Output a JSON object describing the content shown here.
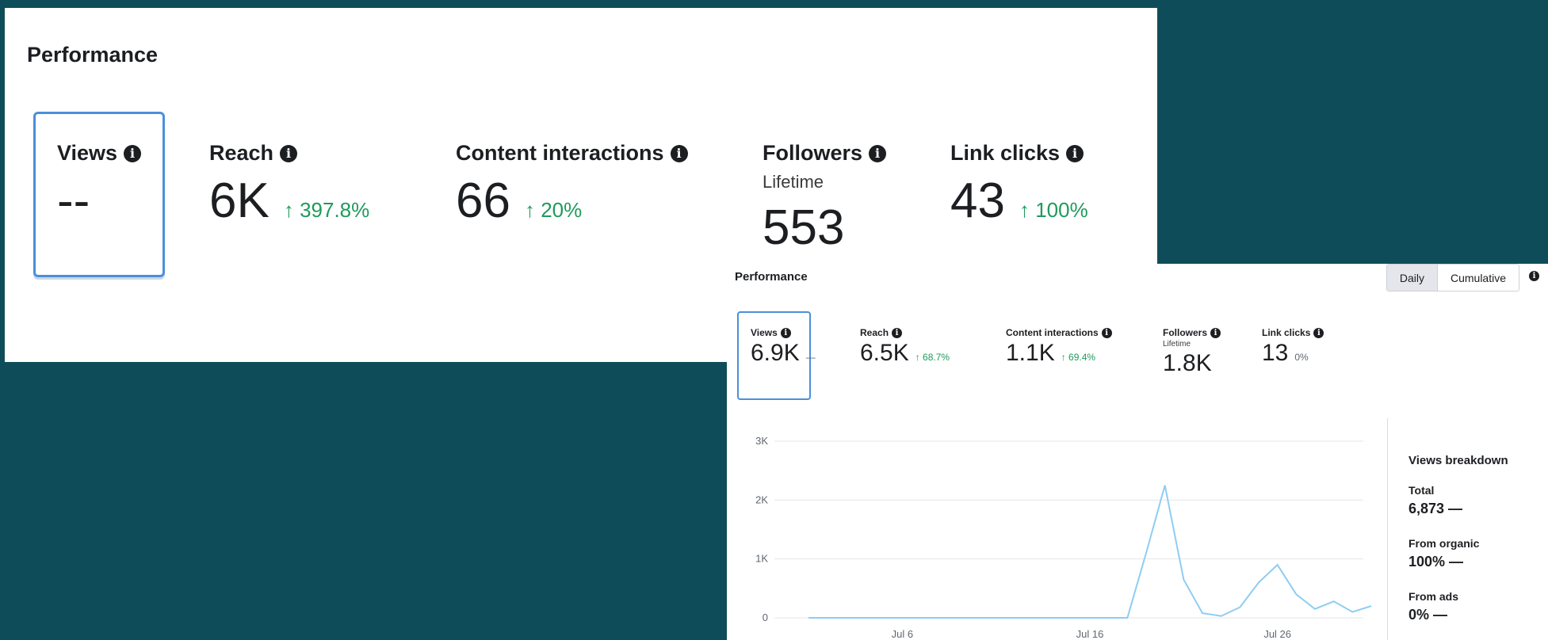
{
  "panel1": {
    "title": "Performance",
    "metrics": [
      {
        "label": "Views",
        "value": "--",
        "delta": ""
      },
      {
        "label": "Reach",
        "value": "6K",
        "delta": "↑ 397.8%"
      },
      {
        "label": "Content interactions",
        "value": "66",
        "delta": "↑ 20%"
      },
      {
        "label": "Followers",
        "sub": "Lifetime",
        "value": "553",
        "delta": ""
      },
      {
        "label": "Link clicks",
        "value": "43",
        "delta": "↑ 100%"
      }
    ]
  },
  "panel2": {
    "title": "Performance",
    "toggle": {
      "daily": "Daily",
      "cumulative": "Cumulative"
    },
    "metrics": [
      {
        "label": "Views",
        "value": "6.9K",
        "delta": "—"
      },
      {
        "label": "Reach",
        "value": "6.5K",
        "delta": "↑ 68.7%"
      },
      {
        "label": "Content interactions",
        "value": "1.1K",
        "delta": "↑ 69.4%"
      },
      {
        "label": "Followers",
        "sub": "Lifetime",
        "value": "1.8K",
        "delta": ""
      },
      {
        "label": "Link clicks",
        "value": "13",
        "delta": "0%"
      }
    ],
    "breakdown": {
      "title": "Views breakdown",
      "items": [
        {
          "label": "Total",
          "value": "6,873 —"
        },
        {
          "label": "From organic",
          "value": "100% —"
        },
        {
          "label": "From ads",
          "value": "0% —"
        }
      ]
    }
  },
  "colors": {
    "line": "#8ecdf2",
    "accent": "#4a90d9",
    "positive": "#1f9a5c",
    "background": "#0f4c59"
  },
  "chart_data": {
    "type": "line",
    "ylim": [
      0,
      3000
    ],
    "yticks": [
      "0",
      "1K",
      "2K",
      "3K"
    ],
    "xticks": [
      {
        "label": "Jul 6",
        "day": 6
      },
      {
        "label": "Jul 16",
        "day": 16
      },
      {
        "label": "Jul 26",
        "day": 26
      }
    ],
    "x": [
      1,
      2,
      3,
      4,
      5,
      6,
      7,
      8,
      9,
      10,
      11,
      12,
      13,
      14,
      15,
      16,
      17,
      18,
      19,
      20,
      21,
      22,
      23,
      24,
      25,
      26,
      27,
      28,
      29,
      30,
      31
    ],
    "values": [
      0,
      0,
      0,
      0,
      0,
      0,
      0,
      0,
      0,
      0,
      0,
      0,
      0,
      0,
      0,
      0,
      0,
      0,
      1100,
      2250,
      650,
      80,
      30,
      180,
      600,
      900,
      400,
      150,
      280,
      100,
      200
    ]
  }
}
